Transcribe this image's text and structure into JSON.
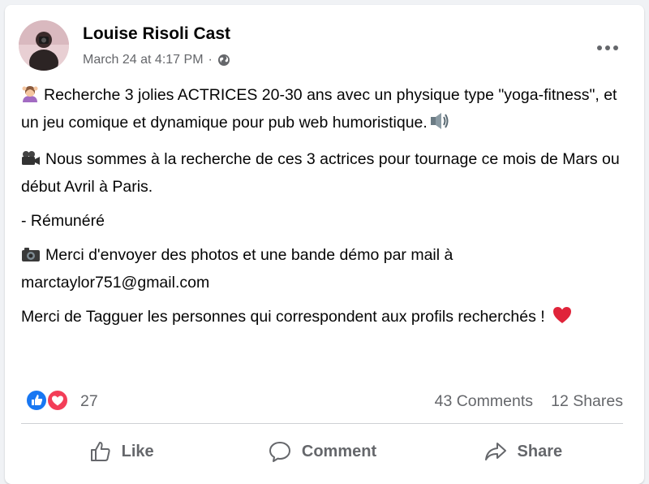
{
  "post": {
    "author_name": "Louise Risoli Cast",
    "timestamp": "March 24 at 4:17 PM",
    "separator": "·",
    "audience_icon": "globe-icon",
    "paragraphs": {
      "p1": "Recherche 3 jolies ACTRICES 20-30 ans avec un physique type \"yoga-fitness\", et un jeu comique et dynamique pour pub web humoristique.",
      "p2": "Nous sommes à la recherche de ces 3 actrices pour tournage ce mois de Mars ou début Avril à Paris.",
      "p3": "- Rémunéré",
      "p4_text": "Merci d'envoyer des photos et une bande démo par mail à",
      "p4_email": "marctaylor751@gmail.com",
      "p5": "Merci de Tagguer les personnes qui correspondent aux profils recherchés !"
    },
    "emoji_icons": [
      "person-gesturing-emoji-icon",
      "speaker-emoji-icon",
      "movie-camera-emoji-icon",
      "camera-emoji-icon",
      "red-heart-emoji-icon"
    ]
  },
  "stats": {
    "reaction_icons": [
      "like-reaction-icon",
      "love-reaction-icon"
    ],
    "reaction_count": "27",
    "comments": "43 Comments",
    "shares": "12 Shares"
  },
  "actions": {
    "like": "Like",
    "comment": "Comment",
    "share": "Share"
  },
  "colors": {
    "like_blue": "#1877f2",
    "love_red": "#f33e58",
    "secondary_text": "#65676b",
    "divider": "#ced0d4"
  }
}
